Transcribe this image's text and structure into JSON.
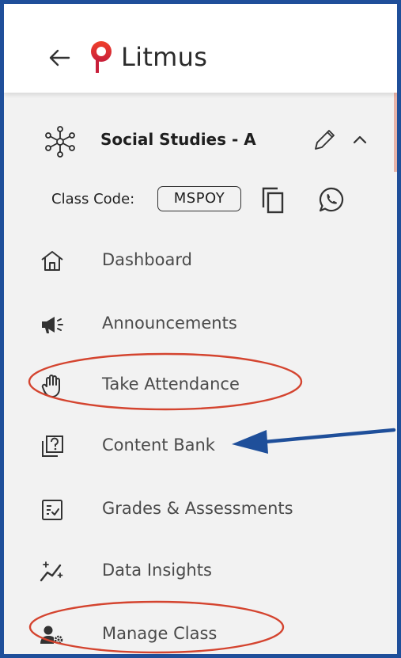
{
  "app": {
    "brand": "Litmus",
    "brand_color": "#e0322a"
  },
  "class_info": {
    "name": "Social Studies - A",
    "code_label": "Class Code:",
    "code": "MSPOY"
  },
  "nav": {
    "items": [
      {
        "label": "Dashboard",
        "icon": "home-icon"
      },
      {
        "label": "Announcements",
        "icon": "megaphone-icon"
      },
      {
        "label": "Take Attendance",
        "icon": "hand-icon"
      },
      {
        "label": "Content Bank",
        "icon": "question-library-icon"
      },
      {
        "label": "Grades & Assessments",
        "icon": "checklist-icon"
      },
      {
        "label": "Data Insights",
        "icon": "sparkle-chart-icon"
      },
      {
        "label": "Manage Class",
        "icon": "user-gear-icon"
      }
    ]
  },
  "annotation_colors": {
    "ellipse": "#d4442f",
    "arrow": "#1f4f9a",
    "frame": "#1f4f9a"
  }
}
